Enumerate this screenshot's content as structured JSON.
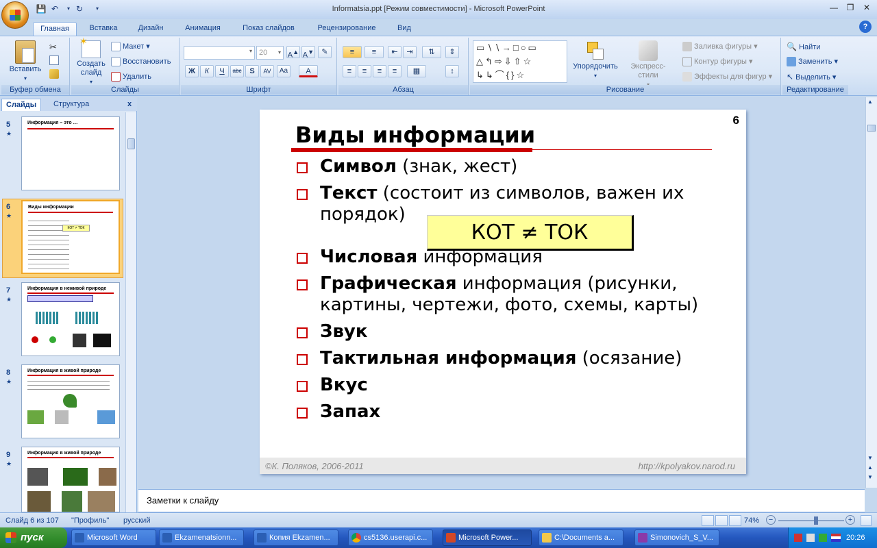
{
  "window": {
    "title": "Informatsia.ppt [Режим совместимости] - Microsoft PowerPoint"
  },
  "ribbon_tabs": [
    "Главная",
    "Вставка",
    "Дизайн",
    "Анимация",
    "Показ слайдов",
    "Рецензирование",
    "Вид"
  ],
  "ribbon": {
    "clipboard": {
      "label": "Буфер обмена",
      "paste": "Вставить"
    },
    "slides": {
      "label": "Слайды",
      "new_slide": "Создать слайд",
      "layout": "Макет",
      "reset": "Восстановить",
      "delete": "Удалить"
    },
    "font": {
      "label": "Шрифт",
      "size": "20"
    },
    "paragraph": {
      "label": "Абзац"
    },
    "drawing": {
      "label": "Рисование",
      "arrange": "Упорядочить",
      "quick_styles": "Экспресс-стили",
      "fill": "Заливка фигуры",
      "outline": "Контур фигуры",
      "effects": "Эффекты для фигур"
    },
    "editing": {
      "label": "Редактирование",
      "find": "Найти",
      "replace": "Заменить",
      "select": "Выделить"
    }
  },
  "left_pane": {
    "tabs": [
      "Слайды",
      "Структура"
    ],
    "close": "x",
    "thumbnails": [
      {
        "num": "5",
        "title": "Информация – это …",
        "selected": false
      },
      {
        "num": "6",
        "title": "Виды информации",
        "selected": true
      },
      {
        "num": "7",
        "title": "Информация в неживой природе",
        "selected": false
      },
      {
        "num": "8",
        "title": "Информация в живой природе",
        "selected": false
      },
      {
        "num": "9",
        "title": "Информация в живой природе",
        "selected": false
      }
    ]
  },
  "slide": {
    "number": "6",
    "title": "Виды информации",
    "bullets": [
      {
        "bold": "Символ",
        "rest": " (знак, жест)"
      },
      {
        "bold": "Текст",
        "rest": " (состоит из символов, важен их порядок)"
      },
      {
        "bold": "Числовая",
        "rest": " информация"
      },
      {
        "bold": "Графическая",
        "rest": " информация (рисунки, картины, чертежи, фото, схемы, карты)"
      },
      {
        "bold": "Звук",
        "rest": ""
      },
      {
        "bold": "Тактильная информация",
        "rest": " (осязание)"
      },
      {
        "bold": "Вкус",
        "rest": ""
      },
      {
        "bold": "Запах",
        "rest": ""
      }
    ],
    "callout": "КОТ ≠ ТОК",
    "footer_left": "©К. Поляков, 2006-2011",
    "footer_right": "http://kpolyakov.narod.ru"
  },
  "notes": {
    "placeholder": "Заметки к слайду"
  },
  "status": {
    "slide": "Слайд 6 из 107",
    "theme": "\"Профиль\"",
    "lang": "русский",
    "zoom": "74%"
  },
  "taskbar": {
    "start": "пуск",
    "tasks": [
      "Microsoft Word",
      "Ekzamenatsionn...",
      "Копия Ekzamen...",
      "cs5136.userapi.c...",
      "Microsoft Power...",
      "C:\\Documents a...",
      "Simonovich_S_V..."
    ],
    "time": "20:26"
  },
  "colors": {
    "accent_red": "#cc0000",
    "callout_bg": "#ffff99",
    "ribbon_text": "#15428b"
  }
}
